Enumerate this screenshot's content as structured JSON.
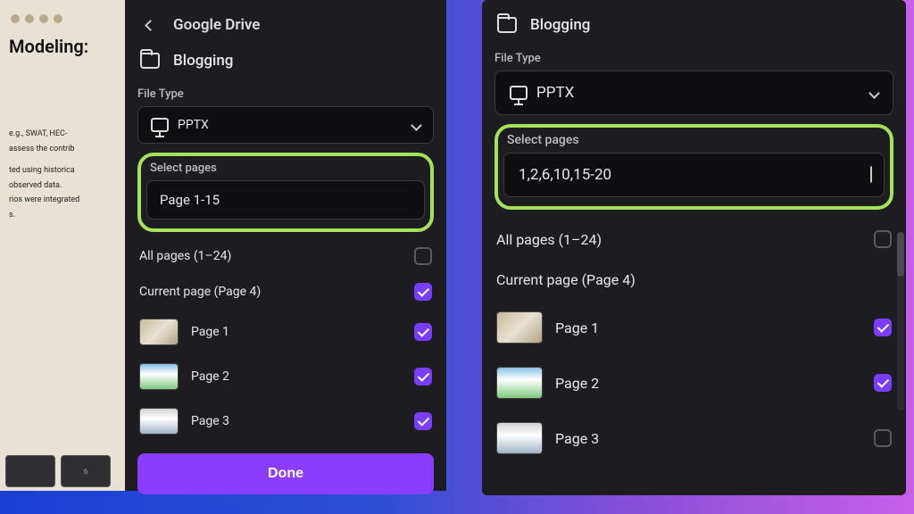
{
  "left": {
    "back_crumb": "Google Drive",
    "folder": "Blogging",
    "file_type_label": "File Type",
    "file_type_value": "PPTX",
    "select_pages_label": "Select pages",
    "pages_input": "Page 1-15",
    "all_pages": "All pages (1–24)",
    "current_page": "Current page (Page 4)",
    "pages": [
      {
        "label": "Page 1",
        "checked": true
      },
      {
        "label": "Page 2",
        "checked": true
      },
      {
        "label": "Page 3",
        "checked": true
      }
    ],
    "done": "Done",
    "slide": {
      "title": "Modeling:",
      "line1": "e.g., SWAT, HEC-",
      "line2": "assess the contrib",
      "line3": "ted using historica",
      "line4": "observed data.",
      "line5": "rios were integrated",
      "line6": "s."
    },
    "thumb_num": "6"
  },
  "right": {
    "folder": "Blogging",
    "file_type_label": "File Type",
    "file_type_value": "PPTX",
    "select_pages_label": "Select pages",
    "pages_input": "1,2,6,10,15-20",
    "all_pages": "All pages (1–24)",
    "current_page": "Current page (Page 4)",
    "pages": [
      {
        "label": "Page 1",
        "checked": true
      },
      {
        "label": "Page 2",
        "checked": true
      },
      {
        "label": "Page 3",
        "checked": false
      }
    ]
  }
}
